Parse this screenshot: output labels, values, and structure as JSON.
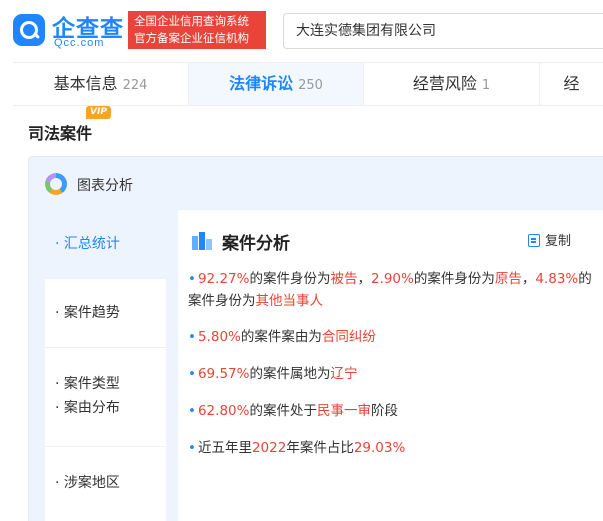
{
  "header": {
    "logo_text": "企查查",
    "logo_sub": "Qcc.com",
    "badge_line1": "全国企业信用查询系统",
    "badge_line2": "官方备案企业征信机构",
    "search_value": "大连实德集团有限公司"
  },
  "tabs": [
    {
      "label": "基本信息",
      "count": "224"
    },
    {
      "label": "法律诉讼",
      "count": "250"
    },
    {
      "label": "经营风险",
      "count": "1"
    },
    {
      "label": "经"
    }
  ],
  "section": {
    "title": "司法案件",
    "vip": "VIP"
  },
  "panel": {
    "title": "图表分析",
    "nav": [
      {
        "label": "汇总统计"
      },
      {
        "label": "案件趋势"
      },
      {
        "label_line1": "案件类型",
        "label_line2": "案由分布"
      },
      {
        "label": "涉案地区"
      }
    ]
  },
  "content": {
    "title": "案件分析",
    "copy_label": "复制",
    "stats": {
      "s1": {
        "v1": "92.27%",
        "t1": "的案件身份为",
        "r1": "被告",
        "t2": "，",
        "v2": "2.90%",
        "t3": "的案件身份为",
        "r2": "原告",
        "t4": "，",
        "v3": "4.83%",
        "t5": "的案件身份为",
        "r3": "其他当事人"
      },
      "s2": {
        "v": "5.80%",
        "t": "的案件案由为",
        "r": "合同纠纷"
      },
      "s3": {
        "v": "69.57%",
        "t": "的案件属地为",
        "r": "辽宁"
      },
      "s4": {
        "v": "62.80%",
        "t1": "的案件处于",
        "r": "民事一审",
        "t2": "阶段"
      },
      "s5": {
        "t1": "近五年里",
        "v1": "2022",
        "t2": "年案件占比",
        "v2": "29.03%"
      }
    }
  },
  "colors": {
    "brand_blue": "#1f86ff",
    "highlight_red": "#e8443a",
    "vip_orange": "#f5a623"
  }
}
